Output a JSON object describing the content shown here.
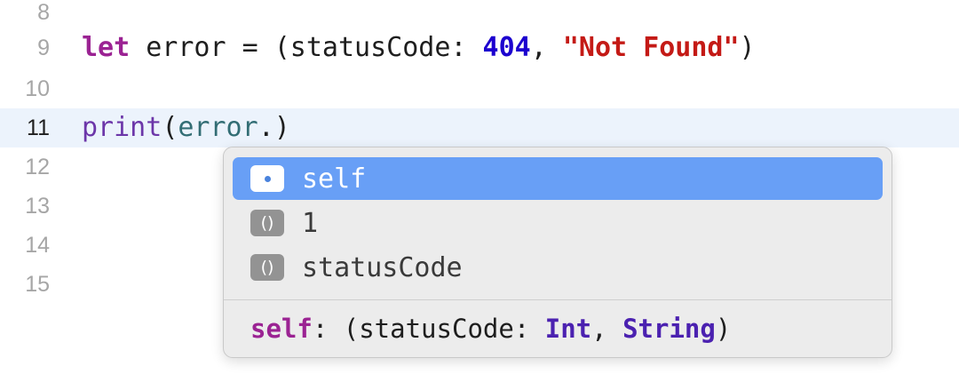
{
  "editor": {
    "lines": [
      {
        "number": "8"
      },
      {
        "number": "9",
        "kw": "let",
        "name": " error = (statusCode: ",
        "num": "404",
        "sep": ", ",
        "str": "\"Not Found\"",
        "close": ")"
      },
      {
        "number": "10"
      },
      {
        "number": "11",
        "fn": "print",
        "open": "(",
        "var": "error",
        "rest": ".)"
      },
      {
        "number": "12"
      },
      {
        "number": "13"
      },
      {
        "number": "14"
      },
      {
        "number": "15"
      }
    ]
  },
  "autocomplete": {
    "items": [
      {
        "label": "self",
        "icon": "property-dot-icon",
        "selected": true
      },
      {
        "label": "1",
        "icon": "tuple-element-icon",
        "badge": "()"
      },
      {
        "label": "statusCode",
        "icon": "tuple-element-icon",
        "badge": "()"
      }
    ],
    "signature": {
      "name": "self",
      "colon": ": (statusCode: ",
      "type1": "Int",
      "comma": ", ",
      "type2": "String",
      "close": ")"
    }
  },
  "colors": {
    "keyword": "#9b2393",
    "number": "#1c00cf",
    "string": "#c41a16",
    "selection": "#689ff6",
    "current_line": "#ecf3fc"
  }
}
